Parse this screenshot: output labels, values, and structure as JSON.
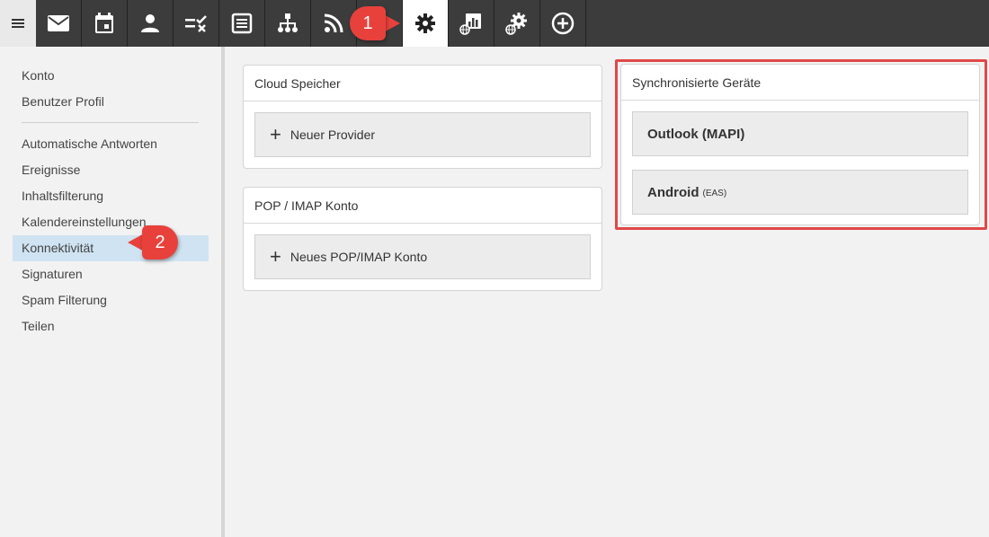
{
  "toolbar": {
    "icons": [
      {
        "name": "mail-icon",
        "active": false
      },
      {
        "name": "calendar-icon",
        "active": false
      },
      {
        "name": "contacts-icon",
        "active": false
      },
      {
        "name": "tasks-icon",
        "active": false
      },
      {
        "name": "notes-icon",
        "active": false
      },
      {
        "name": "org-chart-icon",
        "active": false
      },
      {
        "name": "rss-icon",
        "active": false
      },
      {
        "name": "settings-gear-icon",
        "active": true
      },
      {
        "name": "web-reports-icon",
        "active": false
      },
      {
        "name": "web-settings-icon",
        "active": false
      },
      {
        "name": "add-circle-icon",
        "active": false
      }
    ]
  },
  "callouts": {
    "first": "1",
    "second": "2"
  },
  "sidebar": {
    "group1": [
      "Konto",
      "Benutzer Profil"
    ],
    "group2": [
      "Automatische Antworten",
      "Ereignisse",
      "Inhaltsfilterung",
      "Kalendereinstellungen",
      "Konnektivität",
      "Signaturen",
      "Spam Filterung",
      "Teilen"
    ],
    "selected": "Konnektivität"
  },
  "cloud_card": {
    "title": "Cloud Speicher",
    "button": "Neuer Provider"
  },
  "pop_card": {
    "title": "POP / IMAP Konto",
    "button": "Neues POP/IMAP Konto"
  },
  "sync_card": {
    "title": "Synchronisierte Geräte",
    "outlook": "Outlook (MAPI)",
    "android": "Android",
    "android_suffix": "(EAS)"
  },
  "colors": {
    "toolbar_bg": "#3c3c3c",
    "callout": "#e8413c",
    "selected_item": "#cfe3f2",
    "highlight_border": "#e04848"
  }
}
